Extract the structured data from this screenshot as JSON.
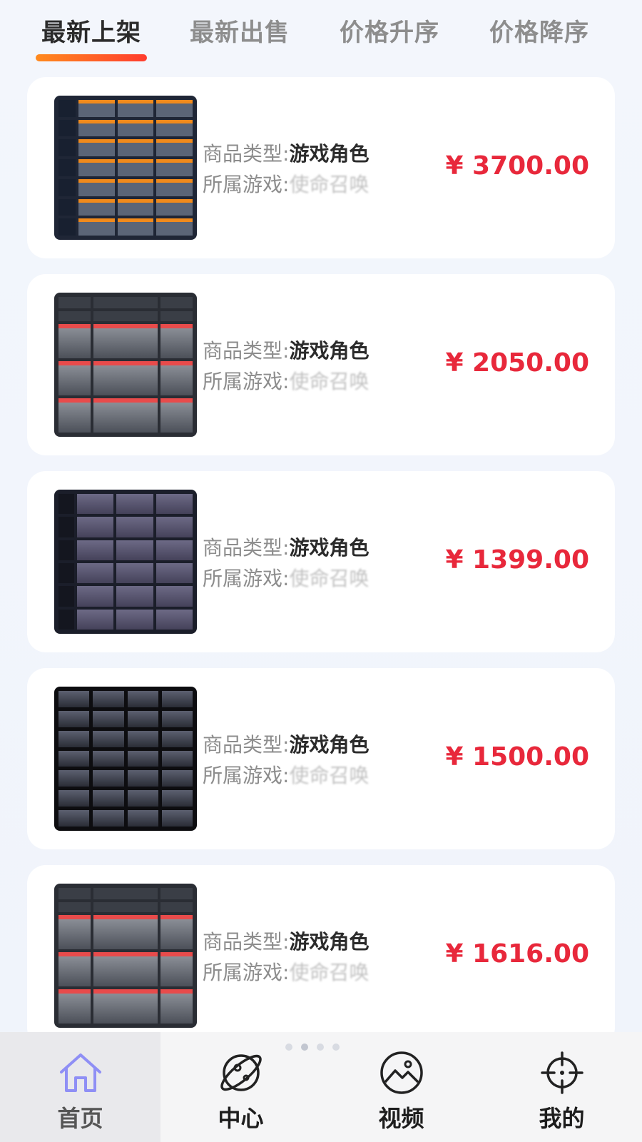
{
  "tabs": [
    {
      "label": "最新上架",
      "active": true
    },
    {
      "label": "最新出售",
      "active": false
    },
    {
      "label": "价格升序",
      "active": false
    },
    {
      "label": "价格降序",
      "active": false
    }
  ],
  "accent_color": "#ff5a26",
  "price_color": "#e8283b",
  "products": [
    {
      "type_label": "商品类型:",
      "type_value": "游戏角色",
      "game_label": "所属游戏:",
      "game_value": "使命召唤",
      "price": "¥ 3700.00"
    },
    {
      "type_label": "商品类型:",
      "type_value": "游戏角色",
      "game_label": "所属游戏:",
      "game_value": "使命召唤",
      "price": "¥ 2050.00"
    },
    {
      "type_label": "商品类型:",
      "type_value": "游戏角色",
      "game_label": "所属游戏:",
      "game_value": "使命召唤",
      "price": "¥ 1399.00"
    },
    {
      "type_label": "商品类型:",
      "type_value": "游戏角色",
      "game_label": "所属游戏:",
      "game_value": "使命召唤",
      "price": "¥ 1500.00"
    },
    {
      "type_label": "商品类型:",
      "type_value": "游戏角色",
      "game_label": "所属游戏:",
      "game_value": "使命召唤",
      "price": "¥ 1616.00"
    }
  ],
  "bottom_nav": [
    {
      "label": "首页",
      "icon": "home-icon",
      "active": true
    },
    {
      "label": "中心",
      "icon": "planet-icon",
      "active": false
    },
    {
      "label": "视频",
      "icon": "image-icon",
      "active": false
    },
    {
      "label": "我的",
      "icon": "crosshair-icon",
      "active": false
    }
  ]
}
